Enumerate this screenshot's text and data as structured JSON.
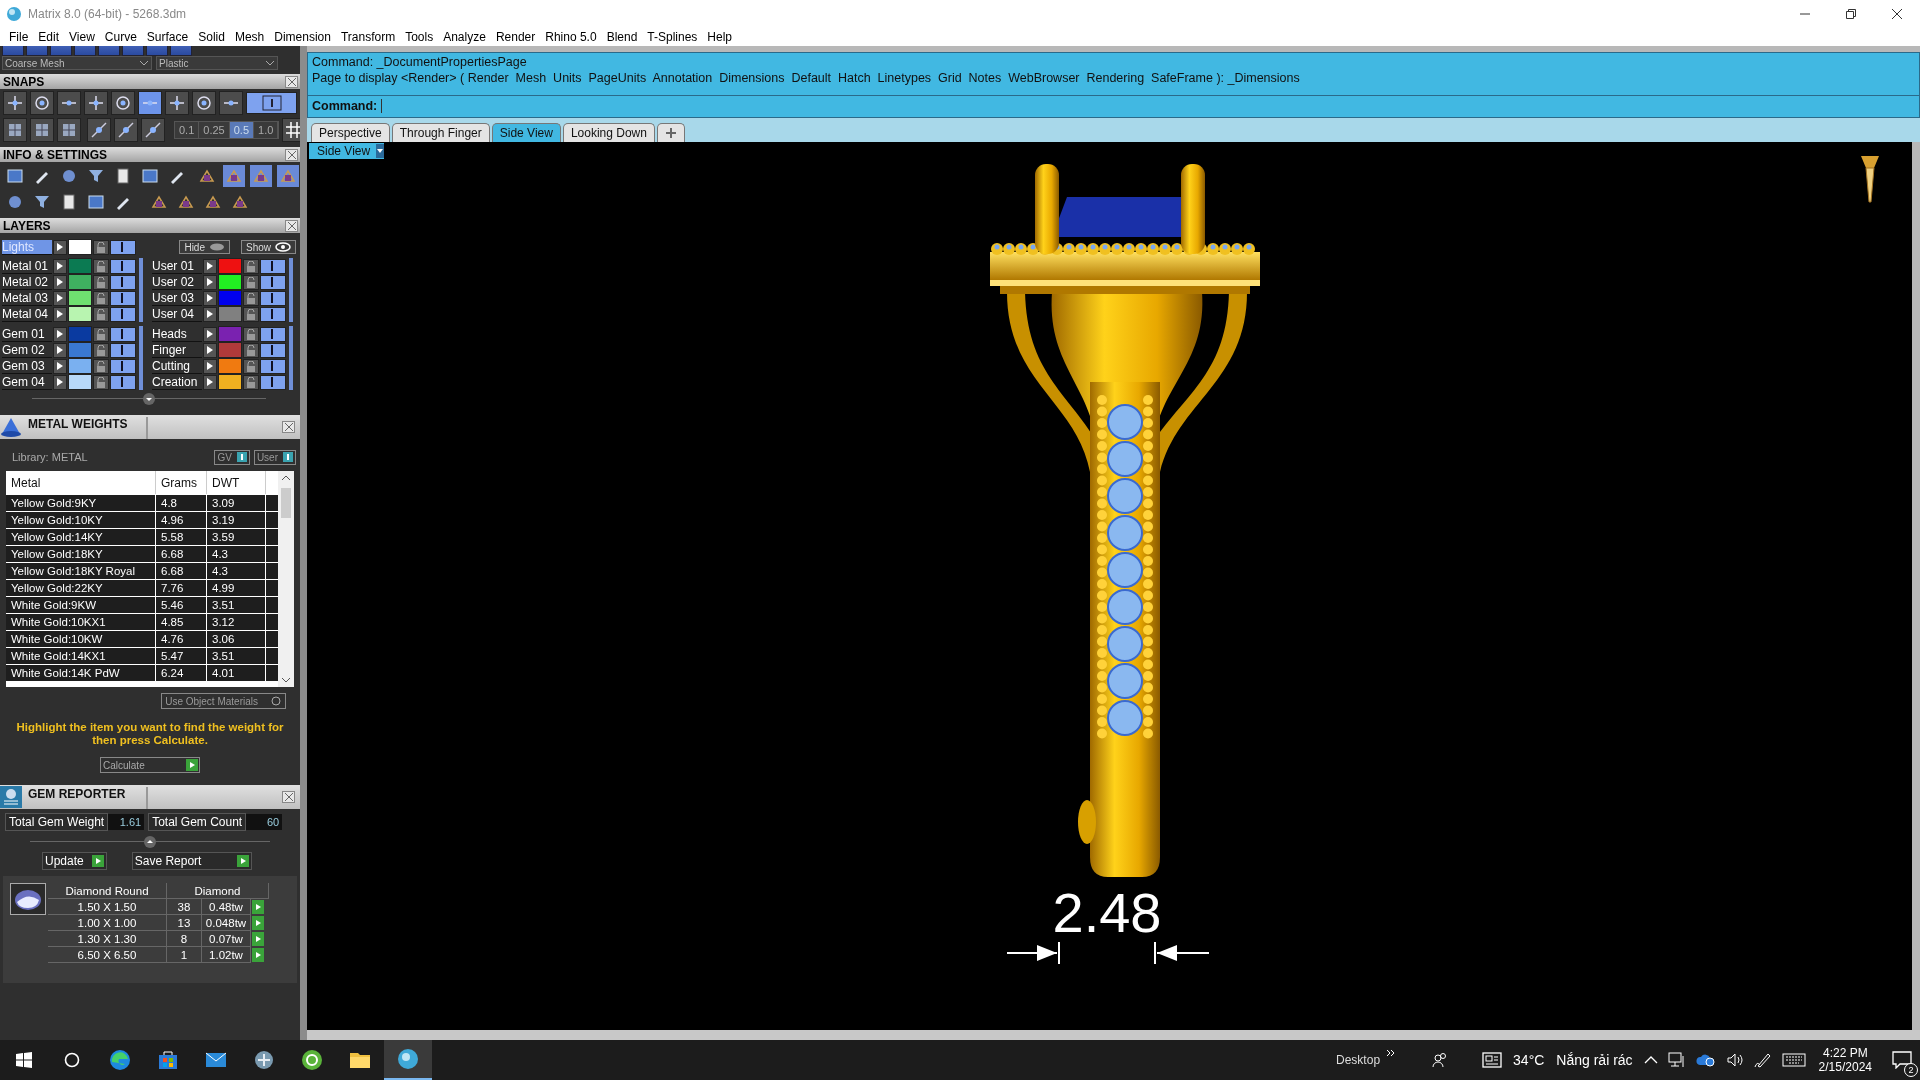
{
  "window": {
    "title": "Matrix 8.0 (64-bit) - 5268.3dm"
  },
  "menu": [
    "File",
    "Edit",
    "View",
    "Curve",
    "Surface",
    "Solid",
    "Mesh",
    "Dimension",
    "Transform",
    "Tools",
    "Analyze",
    "Render",
    "Rhino 5.0",
    "Blend",
    "T-Splines",
    "Help"
  ],
  "display": {
    "mesh": "Coarse Mesh",
    "material": "Plastic"
  },
  "snaps": {
    "title": "SNAPS",
    "toggles": [
      {
        "selected": false
      },
      {
        "selected": false
      },
      {
        "selected": false
      },
      {
        "selected": false
      },
      {
        "selected": false
      },
      {
        "selected": true
      },
      {
        "selected": false
      },
      {
        "selected": false
      },
      {
        "selected": false
      }
    ],
    "mode_toggle": {
      "on": true
    },
    "steps": [
      {
        "label": "0.1",
        "selected": false
      },
      {
        "label": "0.25",
        "selected": false
      },
      {
        "label": "0.5",
        "selected": true
      },
      {
        "label": "1.0",
        "selected": false
      }
    ]
  },
  "info": {
    "title": "INFO & SETTINGS"
  },
  "layers": {
    "title": "LAYERS",
    "lights": {
      "name": "Lights",
      "color": "#ffffff",
      "selected": true,
      "on": true
    },
    "hide": "Hide",
    "show": "Show",
    "groups": [
      {
        "layers": [
          {
            "name": "Metal 01",
            "color": "#0b7a52",
            "on": true
          },
          {
            "name": "Metal 02",
            "color": "#3fb060",
            "on": true
          },
          {
            "name": "Metal 03",
            "color": "#6fe070",
            "on": true
          },
          {
            "name": "Metal 04",
            "color": "#b8f4b0",
            "on": true
          }
        ]
      },
      {
        "layers": [
          {
            "name": "User 01",
            "color": "#ee1111",
            "on": true
          },
          {
            "name": "User 02",
            "color": "#22ee22",
            "on": true
          },
          {
            "name": "User 03",
            "color": "#0000ee",
            "on": true
          },
          {
            "name": "User 04",
            "color": "#808080",
            "on": true
          }
        ]
      },
      {
        "layers": [
          {
            "name": "Gem 01",
            "color": "#0a3aa0",
            "on": true
          },
          {
            "name": "Gem 02",
            "color": "#3a78d0",
            "on": true
          },
          {
            "name": "Gem 03",
            "color": "#7ab0f0",
            "on": true
          },
          {
            "name": "Gem 04",
            "color": "#b8d8f8",
            "on": true
          }
        ]
      },
      {
        "layers": [
          {
            "name": "Heads",
            "color": "#7a22b0",
            "on": true
          },
          {
            "name": "Finger",
            "color": "#b03a3a",
            "on": true
          },
          {
            "name": "Cutting",
            "color": "#f07a10",
            "on": true
          },
          {
            "name": "Creation",
            "color": "#f0b020",
            "on": true
          }
        ]
      }
    ]
  },
  "metal_weights": {
    "title": "METAL WEIGHTS",
    "library": "Library: METAL",
    "toggles": [
      {
        "label": "GV",
        "on": true
      },
      {
        "label": "User",
        "on": true
      }
    ],
    "columns": [
      "Metal",
      "Grams",
      "DWT"
    ],
    "rows": [
      [
        "Yellow Gold:9KY",
        "4.8",
        "3.09"
      ],
      [
        "Yellow Gold:10KY",
        "4.96",
        "3.19"
      ],
      [
        "Yellow Gold:14KY",
        "5.58",
        "3.59"
      ],
      [
        "Yellow Gold:18KY",
        "6.68",
        "4.3"
      ],
      [
        "Yellow Gold:18KY Royal",
        "6.68",
        "4.3"
      ],
      [
        "Yellow Gold:22KY",
        "7.76",
        "4.99"
      ],
      [
        "White Gold:9KW",
        "5.46",
        "3.51"
      ],
      [
        "White Gold:10KX1",
        "4.85",
        "3.12"
      ],
      [
        "White Gold:10KW",
        "4.76",
        "3.06"
      ],
      [
        "White Gold:14KX1",
        "5.47",
        "3.51"
      ],
      [
        "White Gold:14K PdW",
        "6.24",
        "4.01"
      ]
    ],
    "use_object_materials": {
      "label": "Use Object Materials",
      "checked": false
    },
    "hint": "Highlight the item you want to find the weight for then press Calculate.",
    "calculate": "Calculate"
  },
  "gem_reporter": {
    "title": "GEM REPORTER",
    "total_weight": {
      "label": "Total Gem Weight",
      "value": "1.61"
    },
    "total_count": {
      "label": "Total Gem Count",
      "value": "60"
    },
    "update": "Update",
    "save": "Save Report",
    "headers": [
      "Diamond Round",
      "Diamond"
    ],
    "rows": [
      {
        "size": "1.50 X 1.50",
        "count": "38",
        "weight": "0.48tw"
      },
      {
        "size": "1.00 X 1.00",
        "count": "13",
        "weight": "0.048tw"
      },
      {
        "size": "1.30 X 1.30",
        "count": "8",
        "weight": "0.07tw"
      },
      {
        "size": "6.50 X 6.50",
        "count": "1",
        "weight": "1.02tw"
      }
    ]
  },
  "command": {
    "history": [
      "Command: _DocumentPropertiesPage",
      "Page to display <Render> ( Render  Mesh  Units  PageUnits  Annotation  Dimensions  Default  Hatch  Linetypes  Grid  Notes  WebBrowser  Rendering  SafeFrame ): _Dimensions"
    ],
    "prompt": "Command:"
  },
  "tabs": [
    {
      "label": "Perspective",
      "selected": false
    },
    {
      "label": "Through Finger",
      "selected": false
    },
    {
      "label": "Side View",
      "selected": true
    },
    {
      "label": "Looking Down",
      "selected": false
    }
  ],
  "viewport": {
    "name": "Side View",
    "dimension": "2.48"
  },
  "taskbar": {
    "apps": [
      {
        "kind": "edge",
        "selected": false
      },
      {
        "kind": "store",
        "selected": false
      },
      {
        "kind": "mail",
        "selected": false
      },
      {
        "kind": "app",
        "selected": false
      },
      {
        "kind": "green",
        "selected": false
      },
      {
        "kind": "folder",
        "selected": false
      },
      {
        "kind": "matrix",
        "selected": true
      }
    ],
    "desktop": "Desktop",
    "temperature": "34°C",
    "weather": "Nắng rải rác",
    "time": "4:22 PM",
    "date": "2/15/2024",
    "notifications": "2"
  }
}
